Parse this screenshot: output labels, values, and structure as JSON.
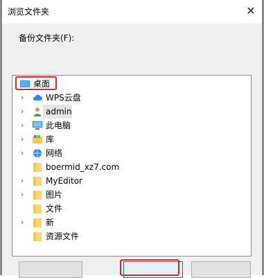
{
  "window": {
    "title": "浏览文件夹",
    "close_glyph": "✕"
  },
  "prompt_label": "备份文件夹(F):",
  "tree": {
    "items": [
      {
        "label": "桌面",
        "icon": "desktop-icon",
        "expandable": false
      },
      {
        "label": "WPS云盘",
        "icon": "cloud-icon",
        "expandable": true
      },
      {
        "label": "admin",
        "icon": "user-icon",
        "expandable": true
      },
      {
        "label": "此电脑",
        "icon": "computer-icon",
        "expandable": true
      },
      {
        "label": "库",
        "icon": "library-icon",
        "expandable": true
      },
      {
        "label": "网络",
        "icon": "network-icon",
        "expandable": true
      },
      {
        "label": "boermid_xz7.com",
        "icon": "folder-icon",
        "expandable": false
      },
      {
        "label": "MyEditor",
        "icon": "folder-icon",
        "expandable": true
      },
      {
        "label": "图片",
        "icon": "folder-icon",
        "expandable": true
      },
      {
        "label": "文件",
        "icon": "folder-icon",
        "expandable": false
      },
      {
        "label": "新",
        "icon": "folder-icon",
        "expandable": true
      },
      {
        "label": "资源文件",
        "icon": "folder-icon",
        "expandable": false
      }
    ],
    "chevron_glyph": "›"
  },
  "colors": {
    "highlight": "#e02020",
    "folder": "#f6d873",
    "selection": "#e5e5e5",
    "accent": "#0078d7"
  }
}
